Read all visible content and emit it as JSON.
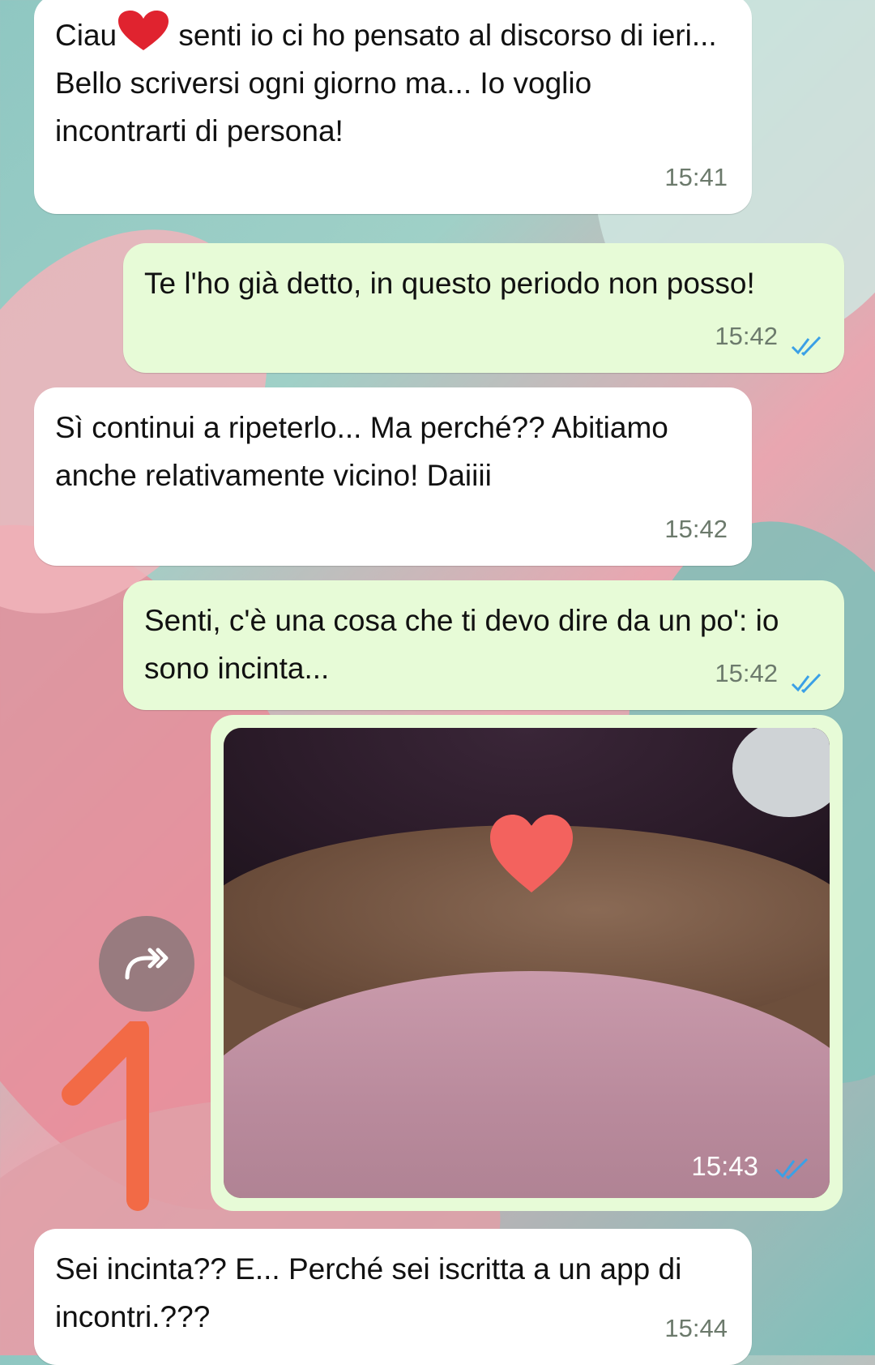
{
  "colors": {
    "incoming_bubble": "#ffffff",
    "outgoing_bubble": "#e7fbd7",
    "read_ticks": "#3ba0e6",
    "annotation": "#f26a46"
  },
  "messages": [
    {
      "direction": "incoming",
      "text_before_emoji": "Ciau",
      "emoji": "red-heart",
      "text": " senti io ci ho pensato al discorso di ieri... Bello scriversi ogni giorno ma... Io voglio incontrarti di persona!",
      "time": "15:41"
    },
    {
      "direction": "outgoing",
      "text": "Te l'ho già detto, in questo periodo non posso!",
      "time": "15:42",
      "status": "read"
    },
    {
      "direction": "incoming",
      "text": "Sì continui a ripeterlo... Ma perché?? Abitiamo anche relativamente vicino! Daiiii",
      "time": "15:42"
    },
    {
      "direction": "outgoing",
      "text": "Senti, c'è una cosa che ti devo dire da un po': io sono incinta...",
      "time": "15:42",
      "status": "read"
    },
    {
      "direction": "outgoing",
      "type": "image",
      "sticker": "heart",
      "time": "15:43",
      "status": "read"
    },
    {
      "direction": "incoming",
      "text": "Sei incinta?? E... Perché sei iscritta a un app di incontri.???",
      "time": "15:44"
    }
  ],
  "forward_button": {
    "icon": "forward-icon"
  },
  "annotation": {
    "icon": "orange-arrow-annotation"
  }
}
